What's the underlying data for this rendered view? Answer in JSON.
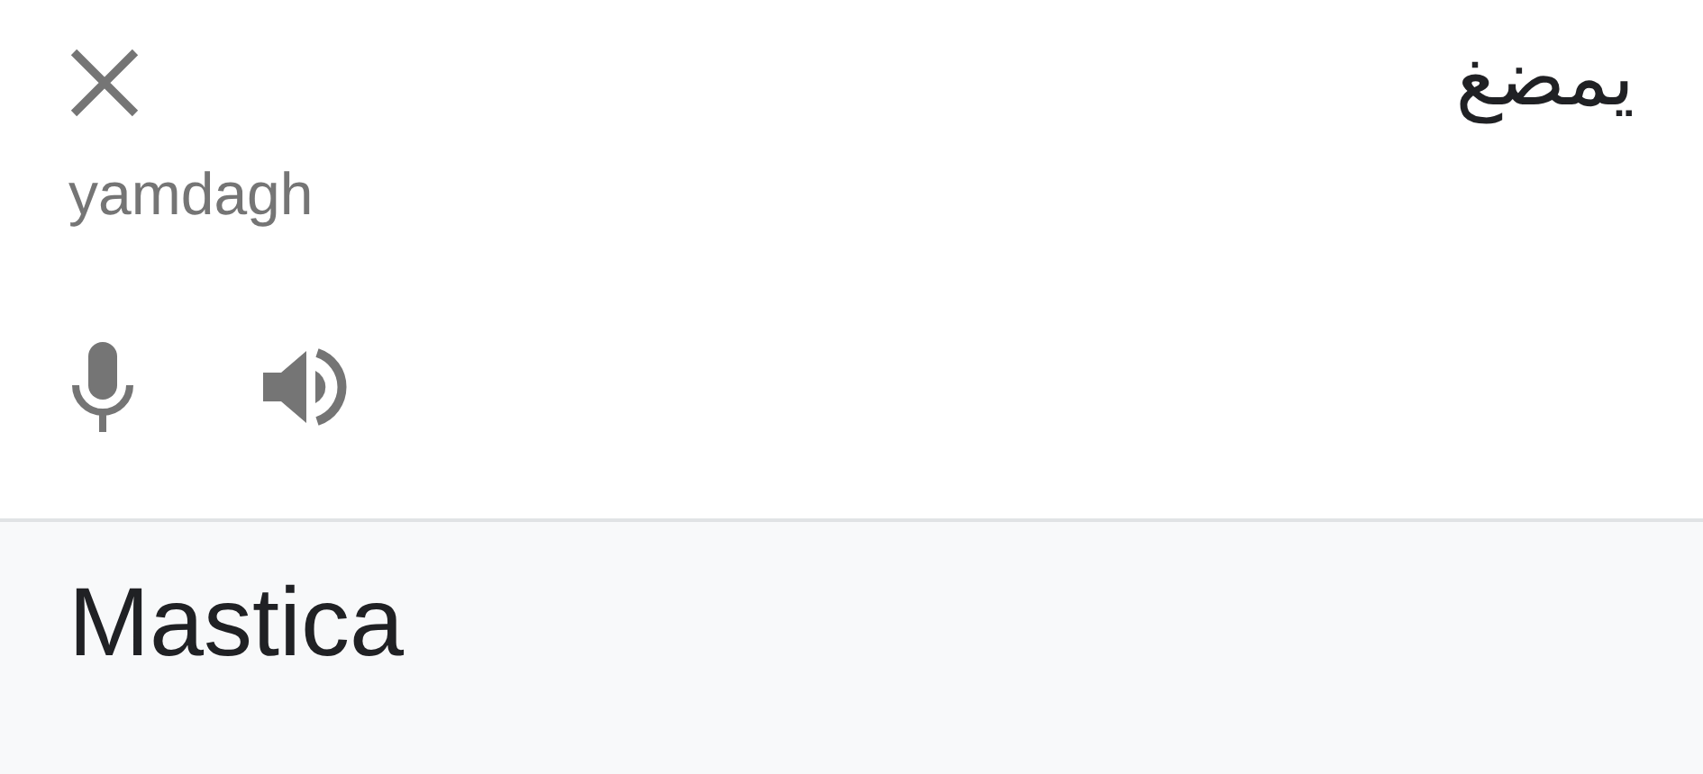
{
  "source": {
    "text": "يمضغ",
    "transliteration": "yamdagh"
  },
  "translation": {
    "text": "Mastica"
  }
}
